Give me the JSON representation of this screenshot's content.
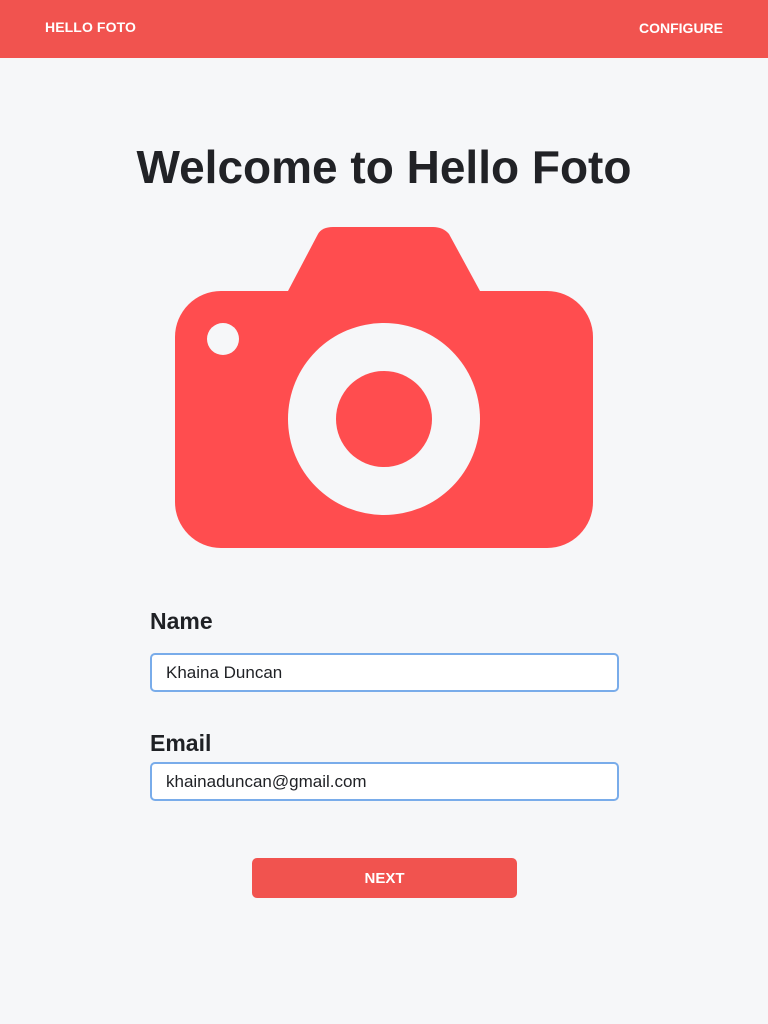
{
  "header": {
    "brand": "HELLO FOTO",
    "configure_label": "CONFIGURE"
  },
  "main": {
    "title": "Welcome to Hello Foto",
    "hero_icon": "camera-icon",
    "form": {
      "name_label": "Name",
      "name_value": "Khaina Duncan",
      "email_label": "Email",
      "email_value": "khainaduncan@gmail.com",
      "next_label": "NEXT"
    }
  },
  "colors": {
    "accent": "#f1534f",
    "camera": "#ff4d4f",
    "input_border": "#79acea",
    "background": "#f6f7f9",
    "text": "#1f2125"
  }
}
